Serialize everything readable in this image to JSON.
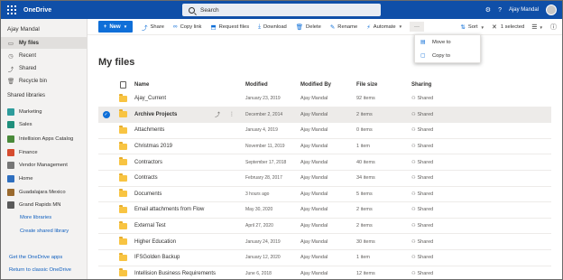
{
  "suitebar": {
    "app_name": "OneDrive",
    "search_placeholder": "Search",
    "settings_icon": "gear-icon",
    "help_label": "?",
    "user_name": "Ajay Mandal"
  },
  "leftnav": {
    "user": "Ajay Mandal",
    "items": [
      {
        "label": "My files",
        "icon": "folder-icon",
        "active": true
      },
      {
        "label": "Recent",
        "icon": "clock-icon",
        "active": false
      },
      {
        "label": "Shared",
        "icon": "share-icon",
        "active": false
      },
      {
        "label": "Recycle bin",
        "icon": "trash-icon",
        "active": false
      }
    ],
    "section_title": "Shared libraries",
    "libraries": [
      {
        "label": "Marketing",
        "color": "#2e9c9c"
      },
      {
        "label": "Sales",
        "color": "#1f8f7c"
      },
      {
        "label": "Intellision Apps Catalog",
        "color": "#4a8a3a"
      },
      {
        "label": "Finance",
        "color": "#d64c2f"
      },
      {
        "label": "Vendor Management",
        "color": "#767676"
      },
      {
        "label": "Home",
        "color": "#2f6fbf"
      },
      {
        "label": "Guadalajara Mexico",
        "color": "#9a6a2e"
      },
      {
        "label": "Grand Rapids MN",
        "color": "#5a5a5a"
      }
    ],
    "more_libraries": "More libraries",
    "create_library": "Create shared library",
    "get_apps": "Get the OneDrive apps",
    "return_classic": "Return to classic OneDrive"
  },
  "commandbar": {
    "new_label": "New",
    "share": "Share",
    "copy_link": "Copy link",
    "request_files": "Request files",
    "download": "Download",
    "delete": "Delete",
    "rename": "Rename",
    "automate": "Automate",
    "more": "···",
    "sort": "Sort",
    "selected": "1 selected"
  },
  "menu": {
    "items": [
      {
        "label": "Move to",
        "icon": "move-icon"
      },
      {
        "label": "Copy to",
        "icon": "copy-icon"
      }
    ]
  },
  "main": {
    "title": "My files",
    "columns": {
      "name": "Name",
      "modified": "Modified",
      "modified_by": "Modified By",
      "file_size": "File size",
      "sharing": "Sharing"
    },
    "rows": [
      {
        "name": "Ajay_Current",
        "modified": "January 23, 2019",
        "modified_by": "Ajay Mandal",
        "size": "92 items",
        "sharing": "Shared",
        "selected": false
      },
      {
        "name": "Archive Projects",
        "modified": "December 2, 2014",
        "modified_by": "Ajay Mandal",
        "size": "2 items",
        "sharing": "Shared",
        "selected": true
      },
      {
        "name": "Attachments",
        "modified": "January 4, 2019",
        "modified_by": "Ajay Mandal",
        "size": "0 items",
        "sharing": "Shared",
        "selected": false
      },
      {
        "name": "Christmas 2019",
        "modified": "November 11, 2019",
        "modified_by": "Ajay Mandal",
        "size": "1 item",
        "sharing": "Shared",
        "selected": false
      },
      {
        "name": "Contractors",
        "modified": "September 17, 2018",
        "modified_by": "Ajay Mandal",
        "size": "40 items",
        "sharing": "Shared",
        "selected": false
      },
      {
        "name": "Contracts",
        "modified": "February 28, 2017",
        "modified_by": "Ajay Mandal",
        "size": "34 items",
        "sharing": "Shared",
        "selected": false
      },
      {
        "name": "Documents",
        "modified": "3 hours ago",
        "modified_by": "Ajay Mandal",
        "size": "5 items",
        "sharing": "Shared",
        "selected": false
      },
      {
        "name": "Email attachments from Flow",
        "modified": "May 30, 2020",
        "modified_by": "Ajay Mandal",
        "size": "2 items",
        "sharing": "Shared",
        "selected": false
      },
      {
        "name": "External Test",
        "modified": "April 27, 2020",
        "modified_by": "Ajay Mandal",
        "size": "2 items",
        "sharing": "Shared",
        "selected": false
      },
      {
        "name": "Higher Education",
        "modified": "January 24, 2019",
        "modified_by": "Ajay Mandal",
        "size": "30 items",
        "sharing": "Shared",
        "selected": false
      },
      {
        "name": "IFSGolden Backup",
        "modified": "January 12, 2020",
        "modified_by": "Ajay Mandal",
        "size": "1 item",
        "sharing": "Shared",
        "selected": false
      },
      {
        "name": "Intellision Business Requirements",
        "modified": "June 6, 2018",
        "modified_by": "Ajay Mandal",
        "size": "12 items",
        "sharing": "Shared",
        "selected": false
      }
    ]
  }
}
